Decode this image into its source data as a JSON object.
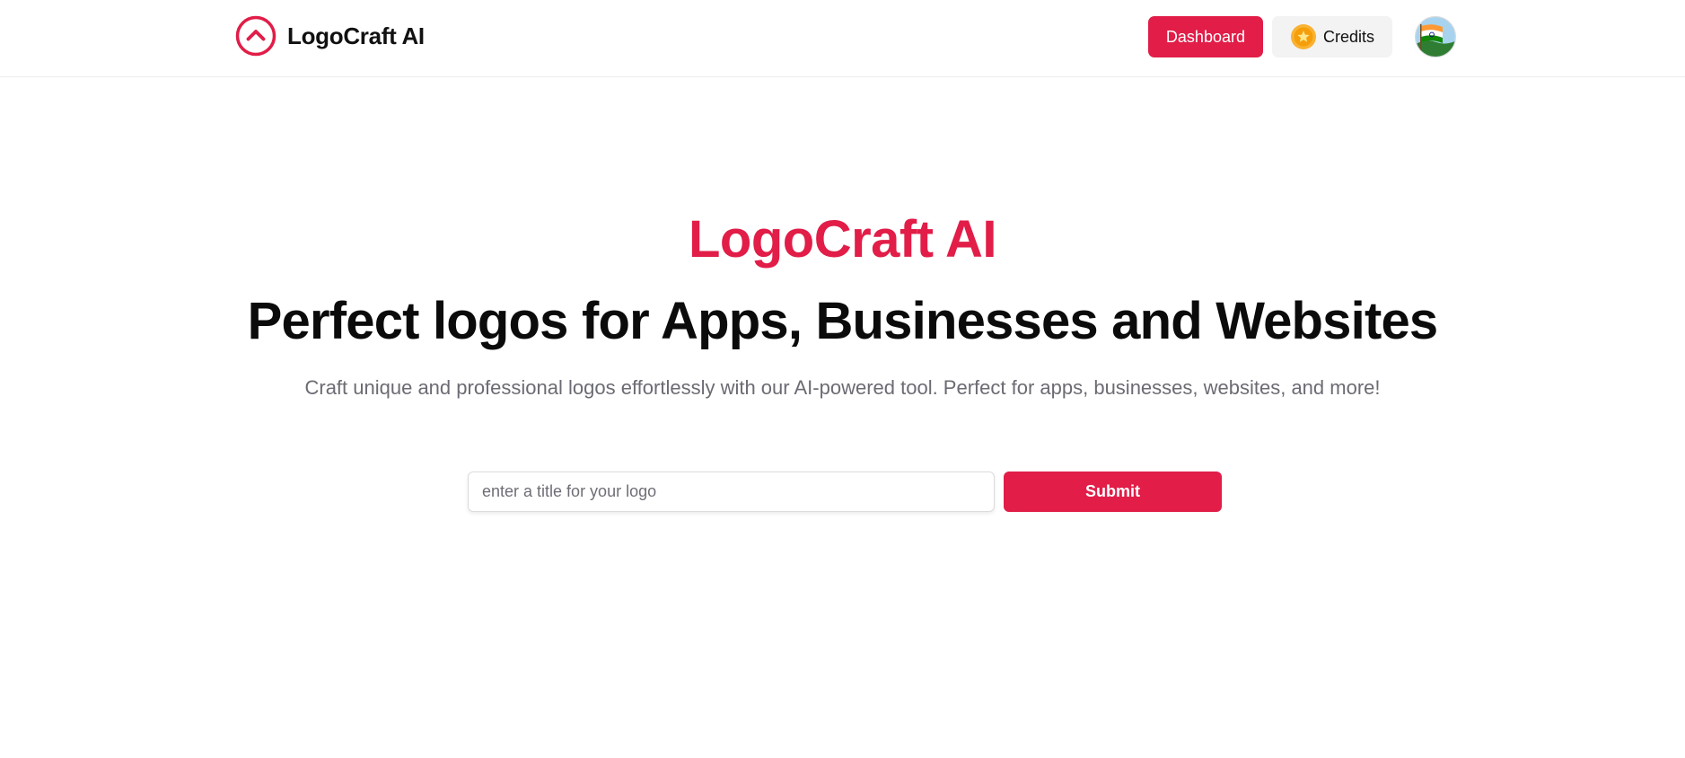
{
  "navbar": {
    "brand_name": "LogoCraft AI",
    "brand_icon": "chevron-up-circle-icon",
    "dashboard_label": "Dashboard",
    "credits_label": "Credits",
    "credits_icon": "coin-star-icon",
    "avatar_icon": "india-flag-avatar"
  },
  "hero": {
    "brand": "LogoCraft AI",
    "title": "Perfect logos for Apps, Businesses and Websites",
    "subtitle": "Craft unique and professional logos effortlessly with our AI-powered tool. Perfect for apps, businesses, websites, and more!"
  },
  "form": {
    "input_value": "",
    "input_placeholder": "enter a title for your logo",
    "submit_label": "Submit"
  },
  "colors": {
    "accent": "#e11d48",
    "credits_bg": "#f3f3f4",
    "subtitle": "#6b6b73"
  }
}
